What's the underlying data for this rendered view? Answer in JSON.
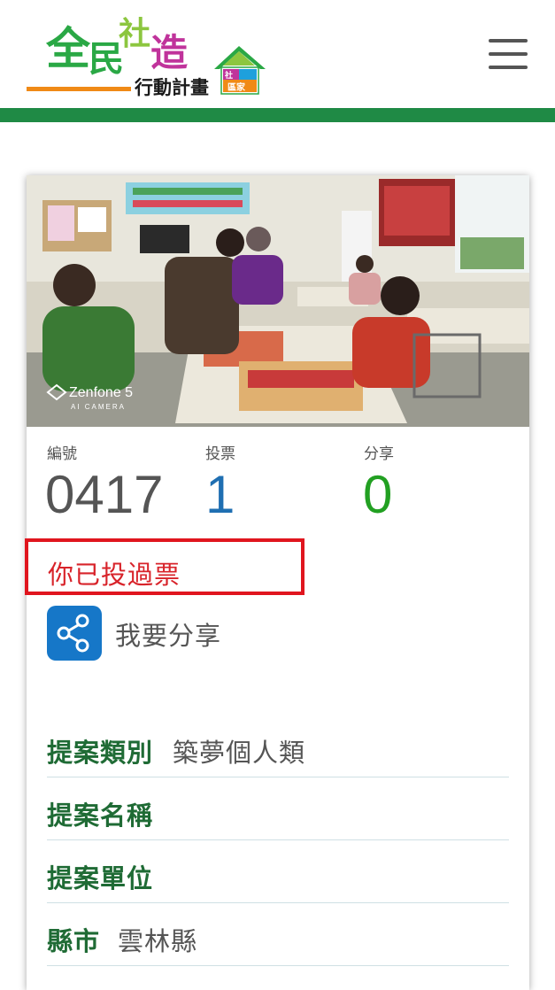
{
  "header": {
    "logo": {
      "char1": "全",
      "char2": "民",
      "char3": "社",
      "char4": "造",
      "subtitle": "行動計畫",
      "house_top": "社",
      "house_bottom": "區家"
    },
    "menu_icon": "hamburger-menu-icon"
  },
  "colors": {
    "brand_green": "#1f8a45",
    "label_green": "#1f6b35",
    "vote_blue": "#1f6fb2",
    "share_green": "#22a022",
    "alert_red": "#e0151e",
    "share_icon_bg": "#1677c8"
  },
  "card": {
    "photo_overlay": {
      "brand": "Zenfone 5",
      "sub": "AI CAMERA"
    },
    "stats": {
      "id_label": "編號",
      "id_value": "0417",
      "vote_label": "投票",
      "vote_value": "1",
      "share_label": "分享",
      "share_value": "0"
    },
    "voted_message": "你已投過票",
    "share_button": {
      "icon": "share-icon",
      "label": "我要分享"
    },
    "info": [
      {
        "key": "提案類別",
        "value": "築夢個人類"
      },
      {
        "key": "提案名稱",
        "value": ""
      },
      {
        "key": "提案單位",
        "value": ""
      },
      {
        "key": "縣市",
        "value": "雲林縣"
      }
    ]
  }
}
